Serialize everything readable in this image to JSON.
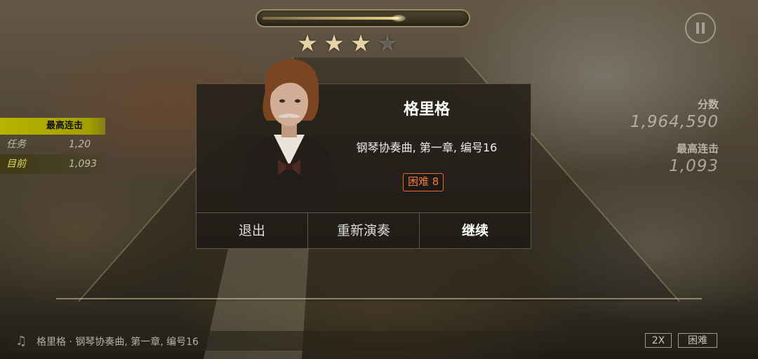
{
  "game": {
    "progress": 0.68,
    "stars": {
      "earned": 3,
      "total": 4
    }
  },
  "combo_panel": {
    "title": "最高连击",
    "rows": [
      {
        "label": "任务",
        "value": "1,20"
      },
      {
        "label": "目前",
        "value": "1,093"
      }
    ]
  },
  "score_panel": {
    "score_label": "分数",
    "score_value": "1,964,590",
    "combo_label": "最高连击",
    "combo_value": "1,093"
  },
  "modal": {
    "composer": "格里格",
    "piece": "钢琴协奏曲, 第一章, 编号16",
    "difficulty": "困难 8",
    "buttons": {
      "exit": "退出",
      "replay": "重新演奏",
      "continue": "继续"
    }
  },
  "bottom": {
    "song_info": "格里格 · 钢琴协奏曲, 第一章, 编号16",
    "speed": "2X",
    "mode": "困难"
  },
  "colors": {
    "accent_yellow": "#b8b400",
    "difficulty_orange": "#ef7a34",
    "star_gold": "#e7d3a6"
  },
  "icons": {
    "pause": "pause-icon",
    "note": "music-note-icon",
    "star": "star-icon"
  }
}
